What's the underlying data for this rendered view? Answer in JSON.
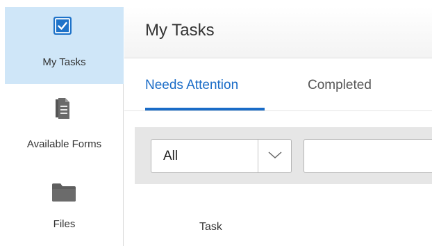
{
  "sidebar": {
    "items": [
      {
        "label": "My Tasks",
        "icon": "checkbox-icon",
        "active": true
      },
      {
        "label": "Available Forms",
        "icon": "document-icon",
        "active": false
      },
      {
        "label": "Files",
        "icon": "folder-icon",
        "active": false
      }
    ]
  },
  "header": {
    "title": "My Tasks"
  },
  "tabs": [
    {
      "label": "Needs Attention",
      "active": true
    },
    {
      "label": "Completed",
      "active": false
    }
  ],
  "filter": {
    "selected": "All",
    "search_value": ""
  },
  "table": {
    "columns": [
      "Task"
    ]
  },
  "colors": {
    "accent": "#1a6cc7",
    "active_nav_bg": "#cfe6f8",
    "filter_bar_bg": "#e6e6e6"
  }
}
